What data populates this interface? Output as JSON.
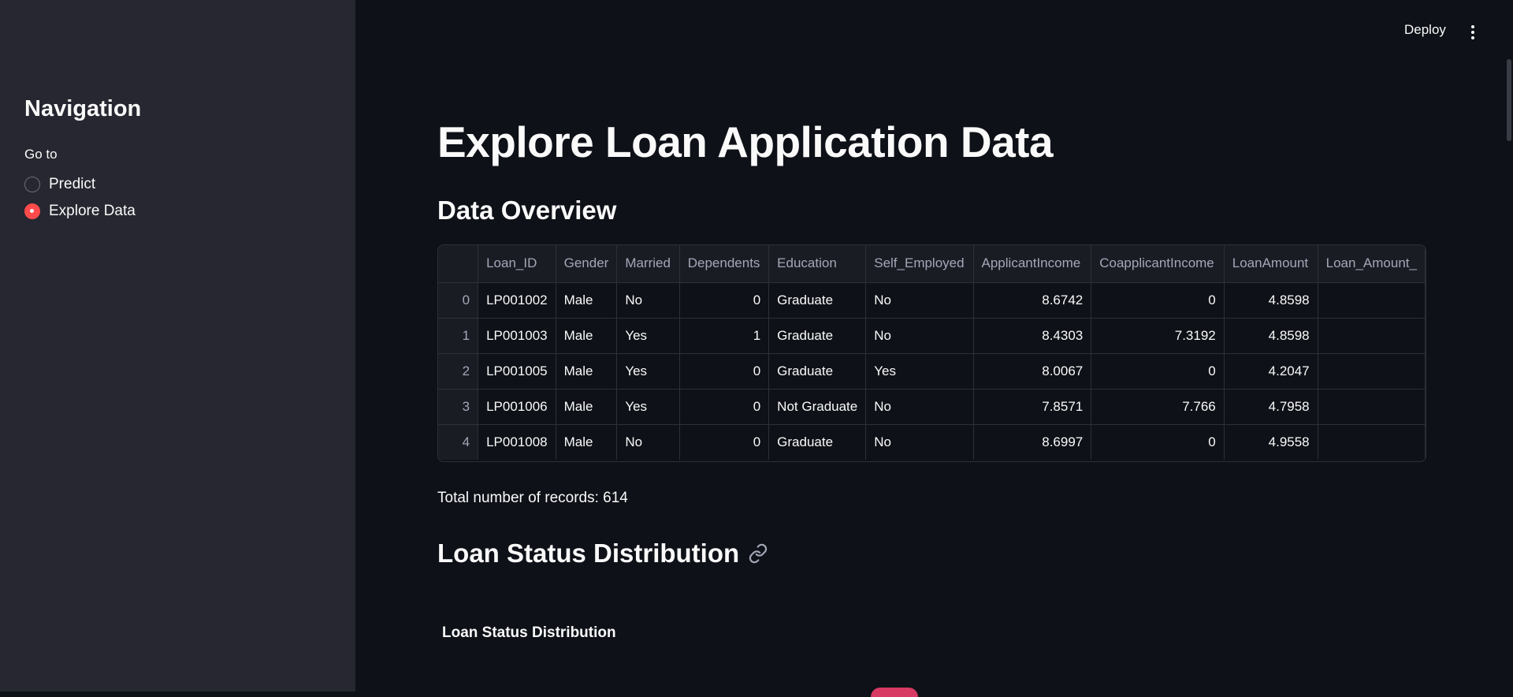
{
  "sidebar": {
    "title": "Navigation",
    "goto_label": "Go to",
    "options": [
      {
        "label": "Predict",
        "selected": false
      },
      {
        "label": "Explore Data",
        "selected": true
      }
    ],
    "accent_color": "#ff4b4b"
  },
  "header": {
    "deploy_label": "Deploy",
    "menu_icon": "kebab-menu-icon"
  },
  "main": {
    "title": "Explore Loan Application Data",
    "overview_heading": "Data Overview",
    "table": {
      "columns": [
        "",
        "Loan_ID",
        "Gender",
        "Married",
        "Dependents",
        "Education",
        "Self_Employed",
        "ApplicantIncome",
        "CoapplicantIncome",
        "LoanAmount",
        "Loan_Amount_"
      ],
      "rows": [
        [
          "0",
          "LP001002",
          "Male",
          "No",
          "0",
          "Graduate",
          "No",
          "8.6742",
          "0",
          "4.8598",
          ""
        ],
        [
          "1",
          "LP001003",
          "Male",
          "Yes",
          "1",
          "Graduate",
          "No",
          "8.4303",
          "7.3192",
          "4.8598",
          ""
        ],
        [
          "2",
          "LP001005",
          "Male",
          "Yes",
          "0",
          "Graduate",
          "Yes",
          "8.0067",
          "0",
          "4.2047",
          ""
        ],
        [
          "3",
          "LP001006",
          "Male",
          "Yes",
          "0",
          "Not Graduate",
          "No",
          "7.8571",
          "7.766",
          "4.7958",
          ""
        ],
        [
          "4",
          "LP001008",
          "Male",
          "No",
          "0",
          "Graduate",
          "No",
          "8.6997",
          "0",
          "4.9558",
          ""
        ]
      ]
    },
    "total_records": "Total number of records: 614",
    "status_heading": "Loan Status Distribution",
    "chart_title": "Loan Status Distribution",
    "link_icon": "link-icon"
  },
  "colors": {
    "background": "#0e1117",
    "sidebar_bg": "#262730",
    "text": "#fafafa"
  }
}
